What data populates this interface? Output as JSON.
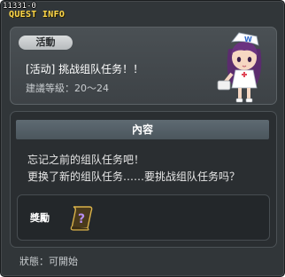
{
  "window": {
    "quest_id": "11331-0",
    "title": "QUEST INFO"
  },
  "quest": {
    "badge": "活動",
    "name": "[活动] 挑战组队任务！！",
    "level": "建議等級：20～24"
  },
  "content": {
    "header": "內容",
    "lines": [
      "忘记之前的组队任务吧！",
      "更换了新的组队任务……要挑战组队任务吗？"
    ]
  },
  "reward": {
    "label": "獎勵",
    "item_icon": "mystery-scroll-icon"
  },
  "status": "狀態：可開始",
  "colors": {
    "title": "#ffd84a",
    "panel": "#3d4246",
    "window": "#313639"
  }
}
